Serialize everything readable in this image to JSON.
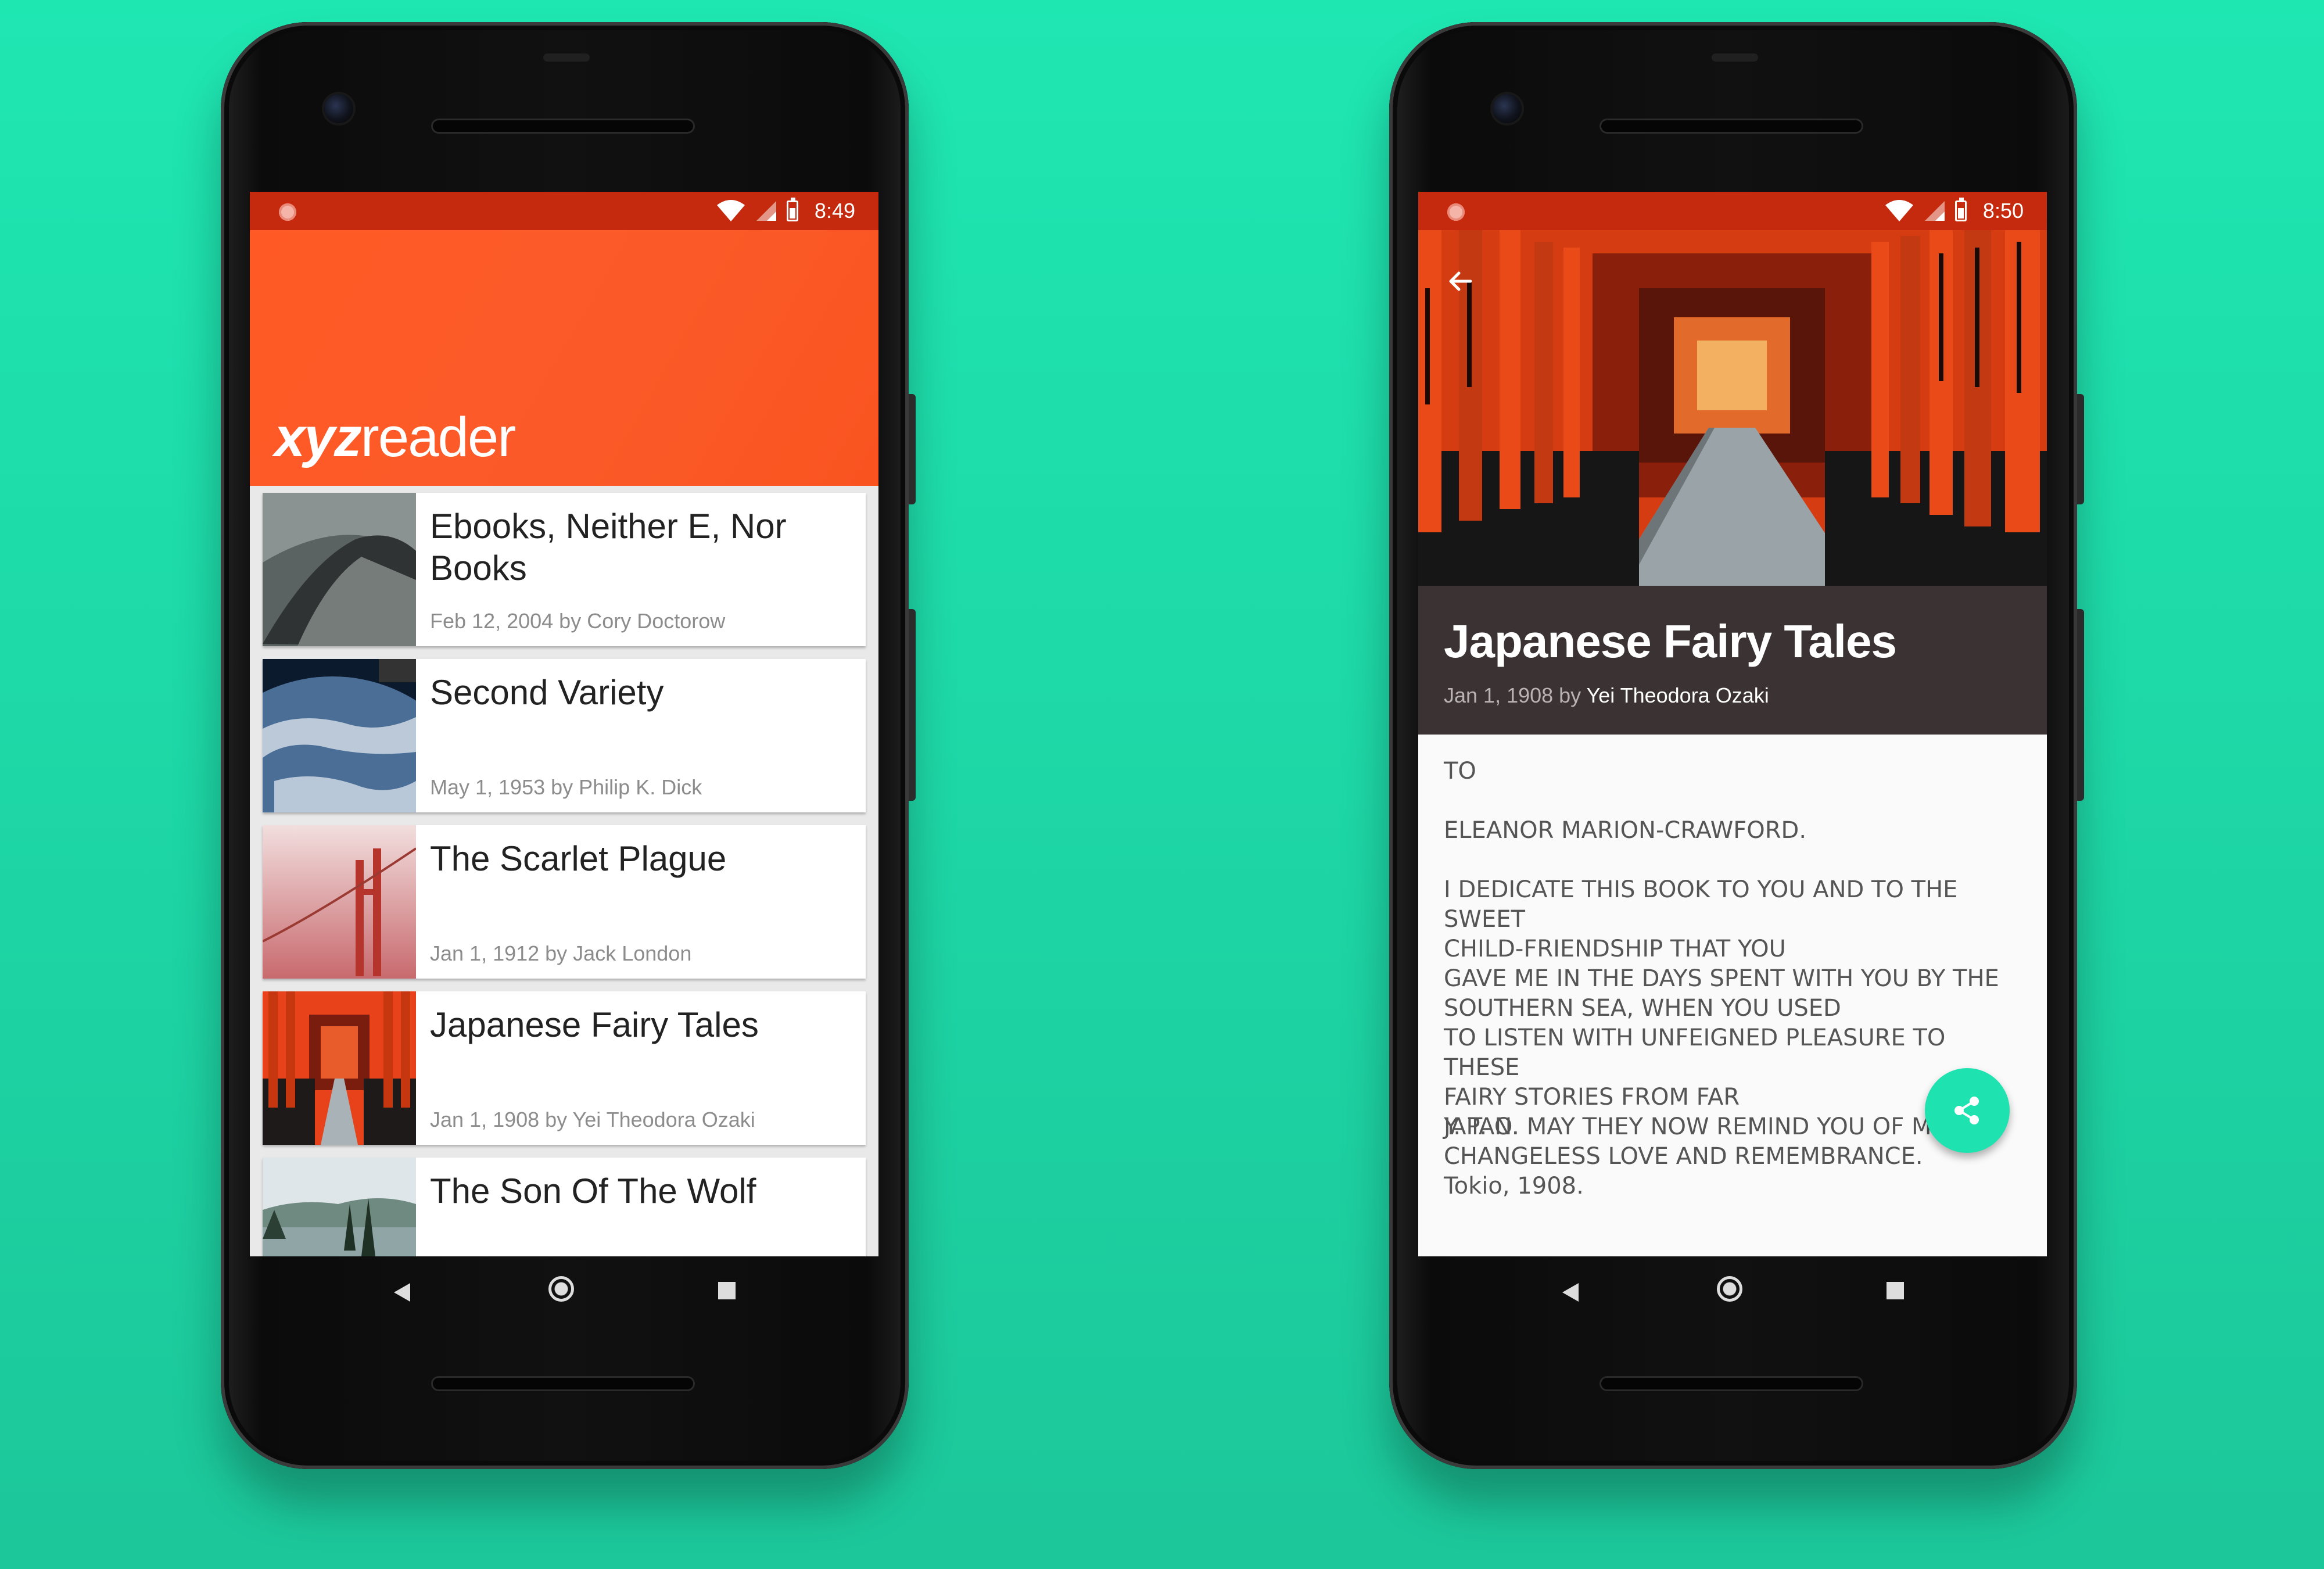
{
  "left_phone": {
    "status": {
      "time": "8:49"
    },
    "app_title": {
      "bold": "xyz",
      "rest": "reader"
    },
    "articles": [
      {
        "title": "Ebooks, Neither E, Nor Books",
        "meta": "Feb 12, 2004 by Cory Doctorow",
        "thumb_icon": "cliff-photo-icon"
      },
      {
        "title": "Second Variety",
        "meta": "May 1, 1953 by Philip K. Dick",
        "thumb_icon": "earth-photo-icon"
      },
      {
        "title": "The Scarlet Plague",
        "meta": "Jan 1, 1912 by Jack London",
        "thumb_icon": "bridge-photo-icon"
      },
      {
        "title": "Japanese Fairy Tales",
        "meta": "Jan 1, 1908 by Yei Theodora Ozaki",
        "thumb_icon": "torii-photo-icon"
      },
      {
        "title": "The Son Of The Wolf",
        "meta": "",
        "thumb_icon": "lake-photo-icon"
      }
    ]
  },
  "right_phone": {
    "status": {
      "time": "8:50"
    },
    "article": {
      "title": "Japanese Fairy Tales",
      "date_prefix": "Jan 1, 1908 by ",
      "author": "Yei Theodora Ozaki",
      "body": [
        "TO",
        "ELEANOR MARION-CRAWFORD.",
        "I DEDICATE THIS BOOK TO YOU AND TO THE SWEET\nCHILD-FRIENDSHIP THAT YOU\nGAVE ME IN THE DAYS SPENT WITH YOU BY THE\nSOUTHERN SEA, WHEN YOU USED\nTO LISTEN WITH UNFEIGNED PLEASURE TO THESE\nFAIRY STORIES FROM FAR\nJAPAN. MAY THEY NOW REMIND YOU OF MY\nCHANGELESS LOVE AND REMEMBRANCE.",
        "Y. T. O.",
        "Tokio, 1908."
      ]
    },
    "fab_icon": "share-icon"
  },
  "colors": {
    "background": "#1fe7b2",
    "app_bar": "#ff5a26",
    "status_bar": "#c62a0e",
    "title_bar": "#3a3233",
    "fab": "#1ee3b0"
  }
}
